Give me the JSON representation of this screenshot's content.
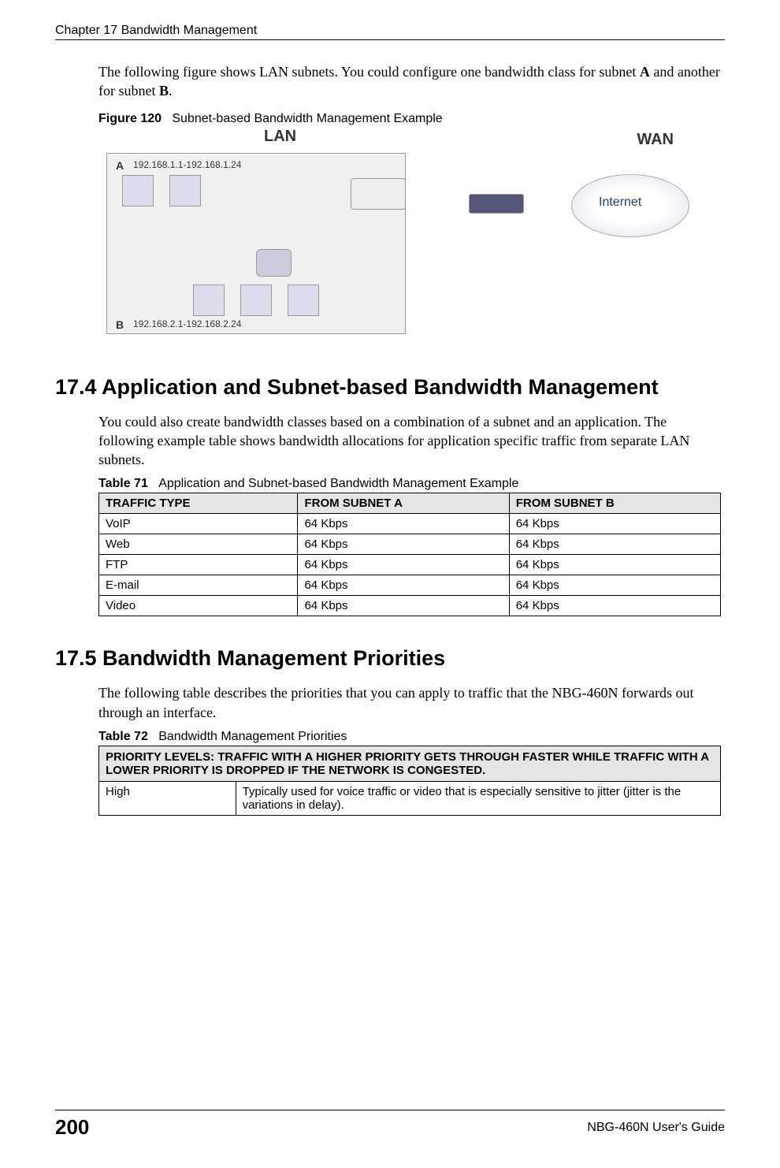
{
  "header": {
    "chapter": "Chapter 17 Bandwidth Management"
  },
  "intro_para_prefix": "The following figure shows LAN subnets. You could configure one bandwidth class for subnet ",
  "intro_para_mid": " and another for subnet ",
  "intro_para_suffix": ".",
  "subnet_a_label": "A",
  "subnet_b_label": "B",
  "figure120": {
    "label": "Figure 120",
    "caption": "Subnet-based Bandwidth Management Example",
    "lan_label": "LAN",
    "wan_label": "WAN",
    "a_label": "A",
    "a_range": "192.168.1.1-192.168.1.24",
    "b_label": "B",
    "b_range": "192.168.2.1-192.168.2.24",
    "internet_label": "Internet"
  },
  "section_17_4": {
    "heading": "17.4  Application and Subnet-based Bandwidth Management",
    "para": "You could also create bandwidth classes based on a combination of a subnet and an application. The following example table shows bandwidth allocations for application specific traffic from separate LAN subnets."
  },
  "table71": {
    "label": "Table 71",
    "caption": "Application and Subnet-based Bandwidth Management Example",
    "headers": [
      "TRAFFIC TYPE",
      "FROM SUBNET A",
      "FROM SUBNET B"
    ],
    "rows": [
      [
        "VoIP",
        "64 Kbps",
        "64 Kbps"
      ],
      [
        "Web",
        "64 Kbps",
        "64 Kbps"
      ],
      [
        "FTP",
        "64 Kbps",
        "64 Kbps"
      ],
      [
        "E-mail",
        "64 Kbps",
        "64 Kbps"
      ],
      [
        "Video",
        "64 Kbps",
        "64 Kbps"
      ]
    ]
  },
  "section_17_5": {
    "heading": "17.5  Bandwidth Management Priorities",
    "para": "The following table describes the priorities that you can apply to traffic that the NBG-460N forwards out through an interface."
  },
  "table72": {
    "label": "Table 72",
    "caption": "Bandwidth Management Priorities",
    "header": "PRIORITY LEVELS: TRAFFIC WITH A HIGHER PRIORITY GETS THROUGH FASTER WHILE TRAFFIC WITH A LOWER PRIORITY IS DROPPED IF THE NETWORK IS CONGESTED.",
    "rows": [
      [
        "High",
        "Typically used for voice traffic or video that is especially sensitive to jitter (jitter is the variations in delay)."
      ]
    ]
  },
  "footer": {
    "page": "200",
    "guide": "NBG-460N User's Guide"
  }
}
